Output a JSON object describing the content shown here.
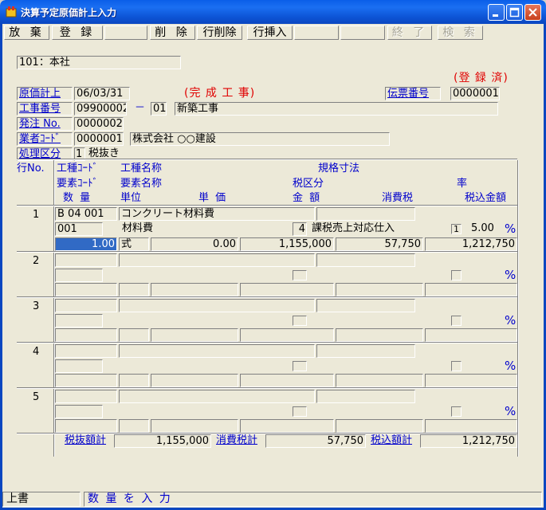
{
  "window": {
    "title": "決算予定原価計上入力"
  },
  "toolbar": {
    "discard": "放 棄",
    "register": "登 録",
    "delete": "削 除",
    "row_delete": "行削除",
    "row_insert": "行挿入",
    "exit": "終 了",
    "search": "検 索"
  },
  "header": {
    "company": "101：本社",
    "status": "(登 録 済)",
    "cost_date_label": "原価計上",
    "cost_date": "06/03/31",
    "completion": "(完 成 工 事)",
    "voucher_label": "伝票番号",
    "voucher_no": "0000001",
    "project_label": "工事番号",
    "project_no": "09900002",
    "dash": "－",
    "project_sub": "01",
    "project_name": "新築工事",
    "order_label": "発注 No.",
    "order_no": "0000002",
    "vendor_label": "業者ｺｰﾄﾞ",
    "vendor_code": "0000001",
    "vendor_name": "株式会社 ○○建設",
    "tax_type_label": "処理区分",
    "tax_type_code": "1",
    "tax_type_name": "税抜き"
  },
  "columns": {
    "row_no": "行No.",
    "work_code": "工種ｺｰﾄﾞ",
    "work_name": "工種名称",
    "spec": "規格寸法",
    "elem_code": "要素ｺｰﾄﾞ",
    "elem_name": "要素名称",
    "tax_class": "税区分",
    "rate": "率",
    "qty": "数 量",
    "unit": "単位",
    "unit_price": "単 価",
    "amount": "金 額",
    "tax": "消費税",
    "total": "税込金額"
  },
  "rows": [
    {
      "no": "1",
      "work_code": "B 04 001",
      "work_name": "コンクリート材料費",
      "elem_code": "001",
      "elem_name": "材料費",
      "tax_class_code": "4",
      "tax_class_name": "課税売上対応仕入",
      "tax_check": "1",
      "rate": "5.00",
      "pct": "%",
      "qty": "1.00",
      "unit": "式",
      "unit_price": "0.00",
      "amount": "1,155,000",
      "tax": "57,750",
      "total": "1,212,750"
    },
    {
      "no": "2",
      "pct": "%"
    },
    {
      "no": "3",
      "pct": "%"
    },
    {
      "no": "4",
      "pct": "%"
    },
    {
      "no": "5",
      "pct": "%"
    }
  ],
  "totals": {
    "net_label": "税抜額計",
    "net": "1,155,000",
    "tax_label": "消費税計",
    "tax": "57,750",
    "gross_label": "税込額計",
    "gross": "1,212,750"
  },
  "statusbar": {
    "mode": "上書",
    "message": "数 量 を 入 力"
  }
}
